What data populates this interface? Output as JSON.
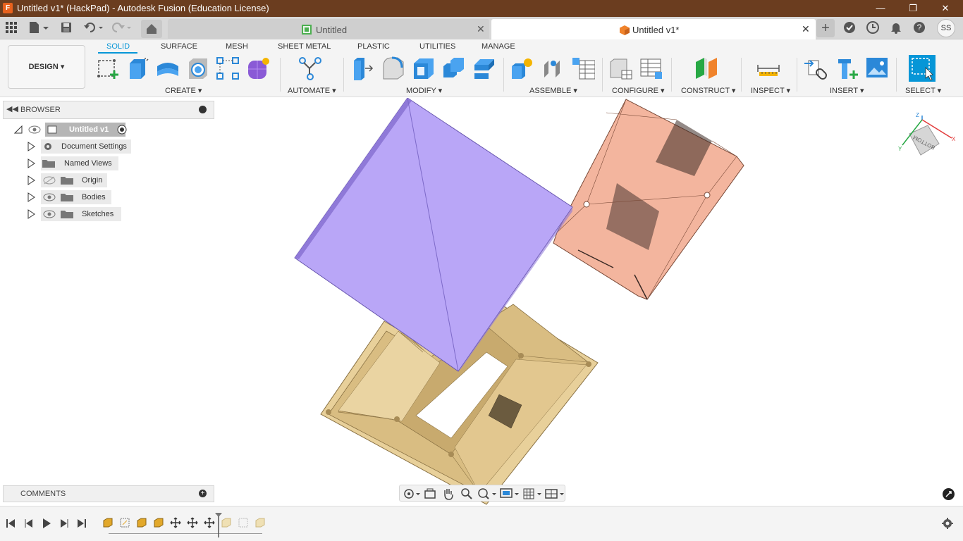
{
  "window": {
    "title": "Untitled v1* (HackPad) - Autodesk Fusion (Education License)",
    "app_icon_letter": "F"
  },
  "tabs": {
    "inactive_label": "Untitled",
    "active_label": "Untitled v1*",
    "user_initials": "SS"
  },
  "workspace": {
    "design_label": "DESIGN",
    "design_caret": "▾",
    "tabs": [
      "SOLID",
      "SURFACE",
      "MESH",
      "SHEET METAL",
      "PLASTIC",
      "UTILITIES",
      "MANAGE"
    ],
    "active_tab": "SOLID"
  },
  "groups": {
    "create": "CREATE ▾",
    "automate": "AUTOMATE ▾",
    "modify": "MODIFY ▾",
    "assemble": "ASSEMBLE ▾",
    "configure": "CONFIGURE ▾",
    "construct": "CONSTRUCT ▾",
    "inspect": "INSPECT ▾",
    "insert": "INSERT ▾",
    "select": "SELECT ▾"
  },
  "browser": {
    "title": "BROWSER",
    "root": "Untitled v1",
    "items": [
      "Document Settings",
      "Named Views",
      "Origin",
      "Bodies",
      "Sketches"
    ]
  },
  "comments": {
    "title": "COMMENTS"
  },
  "viewcube": {
    "face": "BOTTOM",
    "axis_x": "X",
    "axis_y": "Y",
    "axis_z": "Z"
  },
  "colors": {
    "title_bar": "#6b3d1f",
    "accent": "#0696d7",
    "body_purple": "#b9a6f7",
    "body_pink": "#f3b59e",
    "body_tan": "#e8d09a"
  }
}
